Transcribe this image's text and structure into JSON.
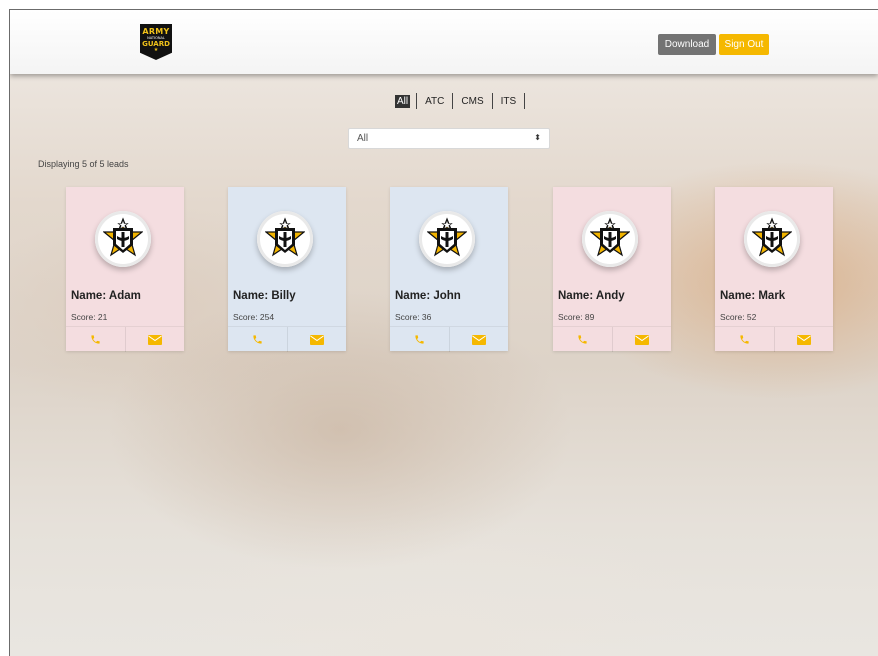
{
  "header": {
    "logo": {
      "line1": "ARMY",
      "line2": "NATIONAL",
      "line3": "GUARD"
    },
    "download_label": "Download",
    "signout_label": "Sign Out"
  },
  "filters": {
    "items": [
      {
        "label": "All",
        "active": true
      },
      {
        "label": "ATC",
        "active": false
      },
      {
        "label": "CMS",
        "active": false
      },
      {
        "label": "ITS",
        "active": false
      }
    ]
  },
  "select": {
    "value": "All"
  },
  "status": {
    "count_text": "Displaying 5 of 5 leads"
  },
  "leads": [
    {
      "name": "Name: Adam",
      "score": "Score: 21",
      "bg": "pink"
    },
    {
      "name": "Name: Billy",
      "score": "Score: 254",
      "bg": "blue"
    },
    {
      "name": "Name: John",
      "score": "Score: 36",
      "bg": "blue"
    },
    {
      "name": "Name: Andy",
      "score": "Score: 89",
      "bg": "pink"
    },
    {
      "name": "Name: Mark",
      "score": "Score: 52",
      "bg": "pink"
    }
  ],
  "colors": {
    "accent": "#f5b800",
    "download": "#737373",
    "card_pink": "#f4dde0",
    "card_blue": "#dde6f1",
    "icon": "#f5b800"
  },
  "icons": {
    "phone": "phone-icon",
    "email": "email-icon",
    "emblem": "army-emblem-icon",
    "select_caret": "chevron-updown-icon"
  }
}
